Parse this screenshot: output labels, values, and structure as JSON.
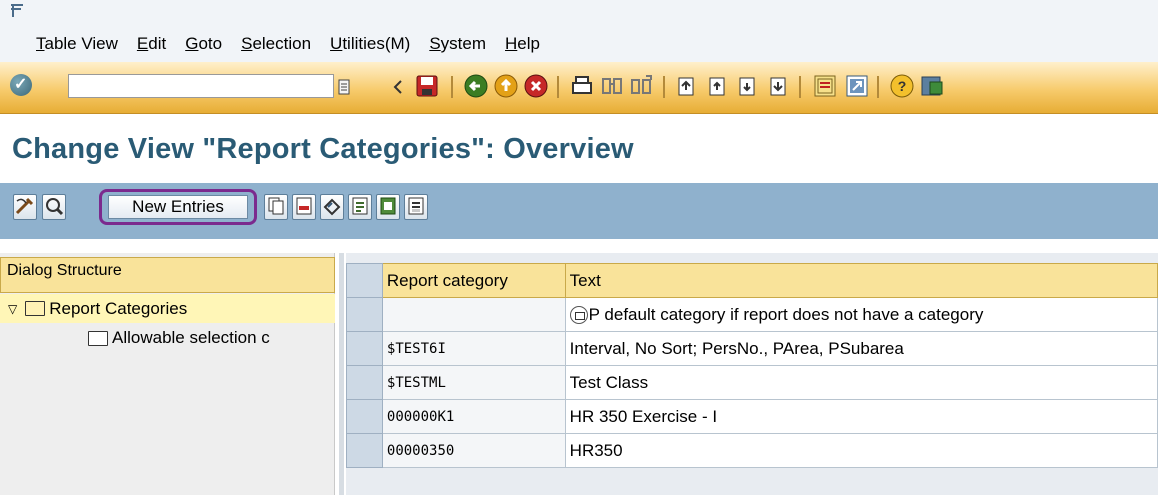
{
  "menu": {
    "items": [
      {
        "label": "Table View",
        "underline_index": 0
      },
      {
        "label": "Edit",
        "underline_index": 0
      },
      {
        "label": "Goto",
        "underline_index": 0
      },
      {
        "label": "Selection",
        "underline_index": 0
      },
      {
        "label": "Utilities(M)",
        "underline_index": 0
      },
      {
        "label": "System",
        "underline_index": 0
      },
      {
        "label": "Help",
        "underline_index": 0
      }
    ]
  },
  "toolbar": {
    "command_field_value": "",
    "icons": [
      "enter-icon",
      "back-icon",
      "exit-icon",
      "cancel-icon",
      "print-icon",
      "find-icon",
      "find-next-icon",
      "first-page-icon",
      "previous-page-icon",
      "next-page-icon",
      "last-page-icon",
      "new-session-icon",
      "shortcut-icon",
      "help-icon",
      "layout-menu-icon"
    ],
    "colors": {
      "accent": "#f7cb6c"
    }
  },
  "page": {
    "title": "Change View \"Report Categories\": Overview"
  },
  "app_toolbar": {
    "new_entries_label": "New Entries",
    "icons": [
      "display-change-icon",
      "find-icon",
      "copy-as-icon",
      "delete-icon",
      "undo-change-icon",
      "select-all-icon",
      "select-block-icon",
      "deselect-all-icon"
    ]
  },
  "dialog_structure": {
    "header": "Dialog Structure",
    "items": [
      {
        "label": "Report Categories"
      },
      {
        "label": "Allowable selection c"
      }
    ]
  },
  "table": {
    "columns": [
      "Report category",
      "Text"
    ],
    "rows": [
      {
        "category": "",
        "text": "P default category if report does not have a category"
      },
      {
        "category": "$TEST6I",
        "text": "Interval, No Sort; PersNo., PArea, PSubarea"
      },
      {
        "category": "$TESTML",
        "text": "Test Class"
      },
      {
        "category": "000000K1",
        "text": "HR 350 Exercise - I"
      },
      {
        "category": "00000350",
        "text": "HR350"
      }
    ]
  }
}
